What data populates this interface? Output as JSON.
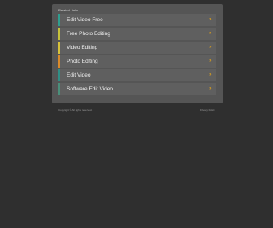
{
  "panel": {
    "title": "Related Links",
    "items": [
      {
        "label": "Edit Video Free",
        "arrow": "»",
        "accent": "#2f9e8f"
      },
      {
        "label": "Free Photo Editing",
        "arrow": "»",
        "accent": "#c6c23a"
      },
      {
        "label": "Video Editing",
        "arrow": "»",
        "accent": "#d6c13a"
      },
      {
        "label": "Photo Editing",
        "arrow": "»",
        "accent": "#d98a2a"
      },
      {
        "label": "Edit Video",
        "arrow": "»",
        "accent": "#2f8f86"
      },
      {
        "label": "Software Edit Video",
        "arrow": "»",
        "accent": "#4a8f7a"
      }
    ]
  },
  "footer": {
    "copyright": "Copyright © All rights reserved.",
    "privacy": "Privacy Policy"
  }
}
